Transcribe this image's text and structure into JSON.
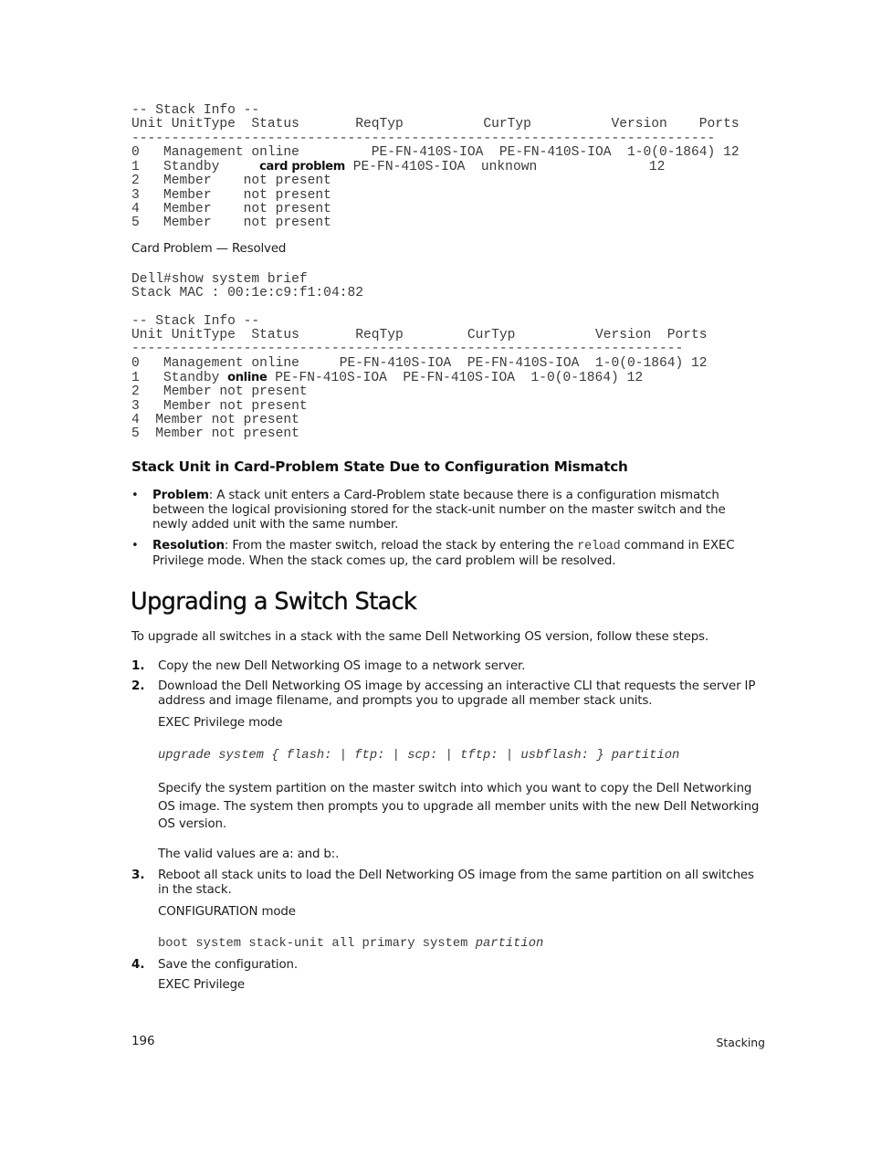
{
  "code_block_1": {
    "title_line": "-- Stack Info --",
    "header_line": "Unit UnitType  Status       ReqTyp          CurTyp          Version    Ports",
    "separator": "-------------------------------------------------------------------------",
    "rows": [
      {
        "pre": "0   Management online         PE-FN-410S-IOA  PE-FN-410S-IOA  1-0(0-1864) 12",
        "bold": "",
        "post": ""
      },
      {
        "pre": "1   Standby     ",
        "bold": "card problem",
        "post": " PE-FN-410S-IOA  unknown              12"
      },
      {
        "pre": "2   Member    not present",
        "bold": "",
        "post": ""
      },
      {
        "pre": "3   Member    not present",
        "bold": "",
        "post": ""
      },
      {
        "pre": "4   Member    not present",
        "bold": "",
        "post": ""
      },
      {
        "pre": "5   Member    not present",
        "bold": "",
        "post": ""
      }
    ]
  },
  "resolved_label": "Card Problem — Resolved",
  "code_block_2": {
    "command_line": "Dell#show system brief",
    "mac_line": "Stack MAC : 00:1e:c9:f1:04:82",
    "title_line": "-- Stack Info --",
    "header_line": "Unit UnitType  Status       ReqTyp        CurTyp          Version  Ports",
    "separator": "---------------------------------------------------------------------",
    "rows": [
      {
        "pre": "0   Management online     PE-FN-410S-IOA  PE-FN-410S-IOA  1-0(0-1864) 12",
        "bold": "",
        "post": ""
      },
      {
        "pre": "1   Standby ",
        "bold": "online",
        "post": " PE-FN-410S-IOA  PE-FN-410S-IOA  1-0(0-1864) 12"
      },
      {
        "pre": "2   Member not present",
        "bold": "",
        "post": ""
      },
      {
        "pre": "3   Member not present",
        "bold": "",
        "post": ""
      },
      {
        "pre": "4  Member not present",
        "bold": "",
        "post": ""
      },
      {
        "pre": "5  Member not present",
        "bold": "",
        "post": ""
      }
    ]
  },
  "section_mismatch": {
    "heading": "Stack Unit in Card-Problem State Due to Configuration Mismatch",
    "bullets": [
      {
        "label": "Problem",
        "text": ": A stack unit enters a Card-Problem state because there is a configuration mismatch between the logical provisioning stored for the stack-unit number on the master switch and the newly added unit with the same number."
      },
      {
        "label": "Resolution",
        "text_before": ": From the master switch, reload the stack by entering the ",
        "code": "reload",
        "text_after": " command in EXEC Privilege mode. When the stack comes up, the card problem will be resolved."
      }
    ]
  },
  "section_upgrade": {
    "heading": "Upgrading a Switch Stack",
    "intro": "To upgrade all switches in a stack with the same Dell Networking OS version, follow these steps.",
    "steps": [
      {
        "num": "1.",
        "text": "Copy the new Dell Networking OS image to a network server."
      },
      {
        "num": "2.",
        "text": "Download the Dell Networking OS image by accessing an interactive CLI that requests the server IP address and image filename, and prompts you to upgrade all member stack units.",
        "mode": "EXEC Privilege mode",
        "command": "upgrade system { flash: | ftp: | scp: | tftp: | usbflash: } partition",
        "description": "Specify the system partition on the master switch into which you want to copy the Dell Networking OS image. The system then prompts you to upgrade all member units with the new Dell Networking OS version.",
        "note": "The valid values are a: and b:."
      },
      {
        "num": "3.",
        "text": "Reboot all stack units to load the Dell Networking OS image from the same partition on all switches in the stack.",
        "mode": "CONFIGURATION mode",
        "command_plain": "boot system stack-unit all primary system ",
        "command_italic": "partition"
      },
      {
        "num": "4.",
        "text": "Save the configuration.",
        "mode": "EXEC Privilege"
      }
    ]
  },
  "footer": {
    "page_number": "196",
    "chapter": "Stacking"
  }
}
